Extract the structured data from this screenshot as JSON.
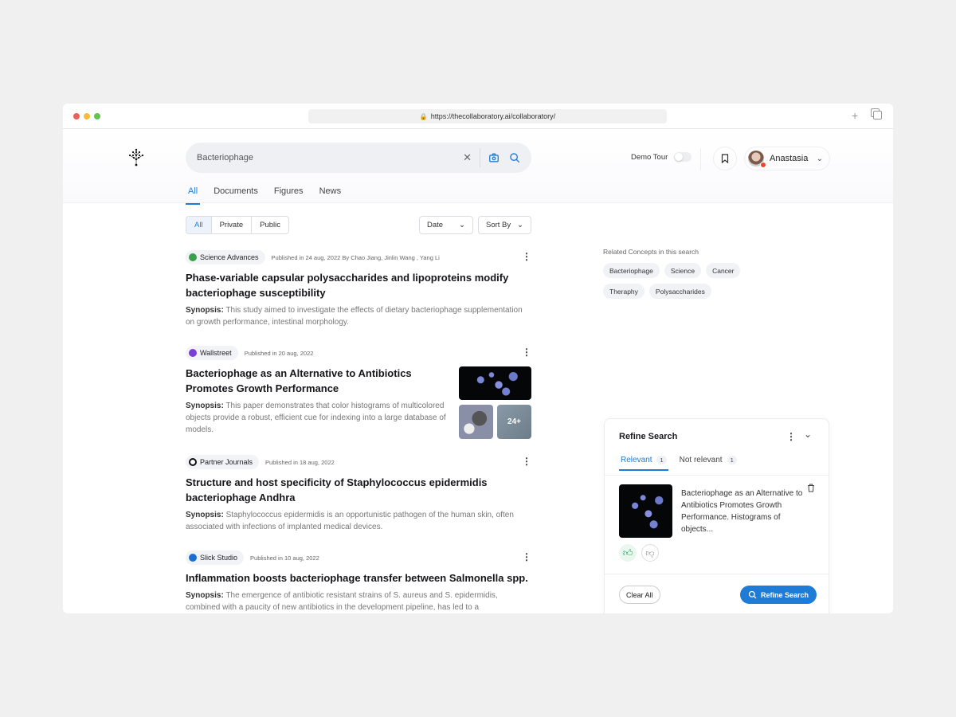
{
  "browser": {
    "url": "https://thecollaboratory.ai/collaboratory/",
    "colors": {
      "close": "#ee5f58",
      "min": "#f6bd3c",
      "max": "#5fc54b"
    }
  },
  "header": {
    "search_value": "Bacteriophage",
    "demo_tour": "Demo Tour",
    "demo_tour_on": false,
    "user_name": "Anastasia"
  },
  "tabs": [
    "All",
    "Documents",
    "Figures",
    "News"
  ],
  "filters": {
    "visibility": [
      "All",
      "Private",
      "Public"
    ],
    "date": "Date",
    "sort": "Sort By"
  },
  "results": [
    {
      "source": "Science Advances",
      "source_color": "#3aa04a",
      "published": "Published in 24 aug, 2022 By Chao Jiang, Jinlin Wang , Yang Li",
      "title": "Phase-variable capsular polysaccharides and lipoproteins modify bacteriophage susceptibility",
      "synopsis_label": "Synopsis:",
      "synopsis": "This study aimed to investigate the effects of dietary bacteriophage supplementation on growth performance, intestinal morphology."
    },
    {
      "source": "Wallstreet",
      "source_color": "#7a3ed6",
      "published": "Published in 20 aug, 2022",
      "title": "Bacteriophage as an Alternative to Antibiotics Promotes Growth Performance",
      "synopsis_label": "Synopsis:",
      "synopsis": "This paper demonstrates that color histograms of multicolored objects provide a robust, efficient cue for indexing into a large database of models.",
      "more_images": "24+"
    },
    {
      "source": "Partner Journals",
      "source_color": "#111111",
      "published": "Published in 18 aug, 2022",
      "title": "Structure and host specificity of Staphylococcus epidermidis bacteriophage Andhra",
      "synopsis_label": "Synopsis:",
      "synopsis": "Staphylococcus epidermidis is an opportunistic pathogen of the human skin, often associated with infections of implanted medical devices."
    },
    {
      "source": "Slick Studio",
      "source_color": "#1a6fd0",
      "published": "Published in 10 aug, 2022",
      "title": "Inflammation boosts bacteriophage transfer between Salmonella spp.",
      "synopsis_label": "Synopsis:",
      "synopsis": "The emergence of antibiotic resistant strains of S. aureus and S. epidermidis, combined with a paucity of new antibiotics in the development pipeline, has led to a"
    }
  ],
  "related": {
    "label": "Related Concepts in this search",
    "chips": [
      "Bacteriophage",
      "Science",
      "Cancer",
      "Theraphy",
      "Polysaccharides"
    ]
  },
  "refine": {
    "title": "Refine Search",
    "tab_relevant": "Relevant",
    "relevant_count": "1",
    "tab_not_relevant": "Not relevant",
    "not_relevant_count": "1",
    "item_text": "Bacteriophage as an Alternative to Antibiotics Promotes Growth Performance. Histograms of objects...",
    "clear_all": "Clear All",
    "refine_button": "Refine Search"
  }
}
